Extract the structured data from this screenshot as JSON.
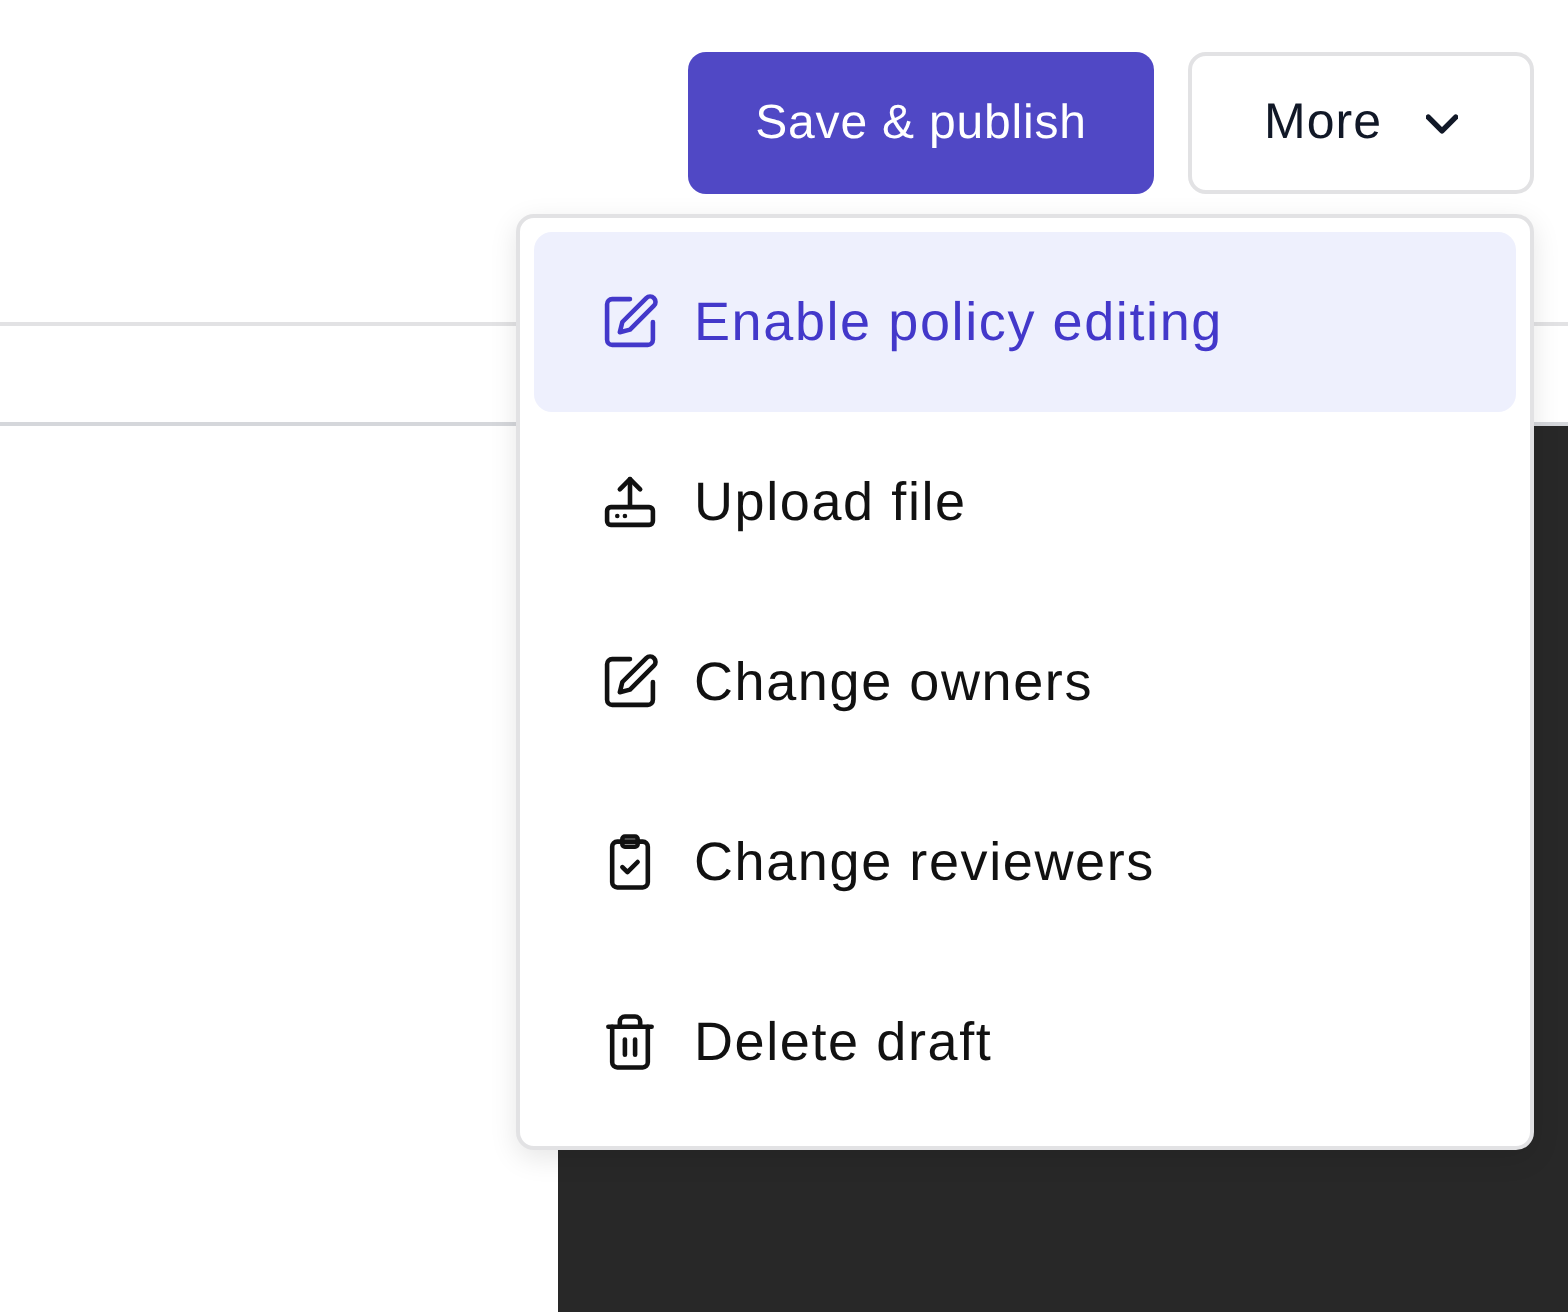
{
  "toolbar": {
    "primary_button": "Save & publish",
    "more_button": "More"
  },
  "menu": {
    "items": [
      {
        "label": "Enable policy editing",
        "kind": "edit",
        "selected": true
      },
      {
        "label": "Upload file",
        "kind": "upload",
        "selected": false
      },
      {
        "label": "Change owners",
        "kind": "edit",
        "selected": false
      },
      {
        "label": "Change reviewers",
        "kind": "clipboard",
        "selected": false
      },
      {
        "label": "Delete draft",
        "kind": "trash",
        "selected": false
      }
    ]
  }
}
